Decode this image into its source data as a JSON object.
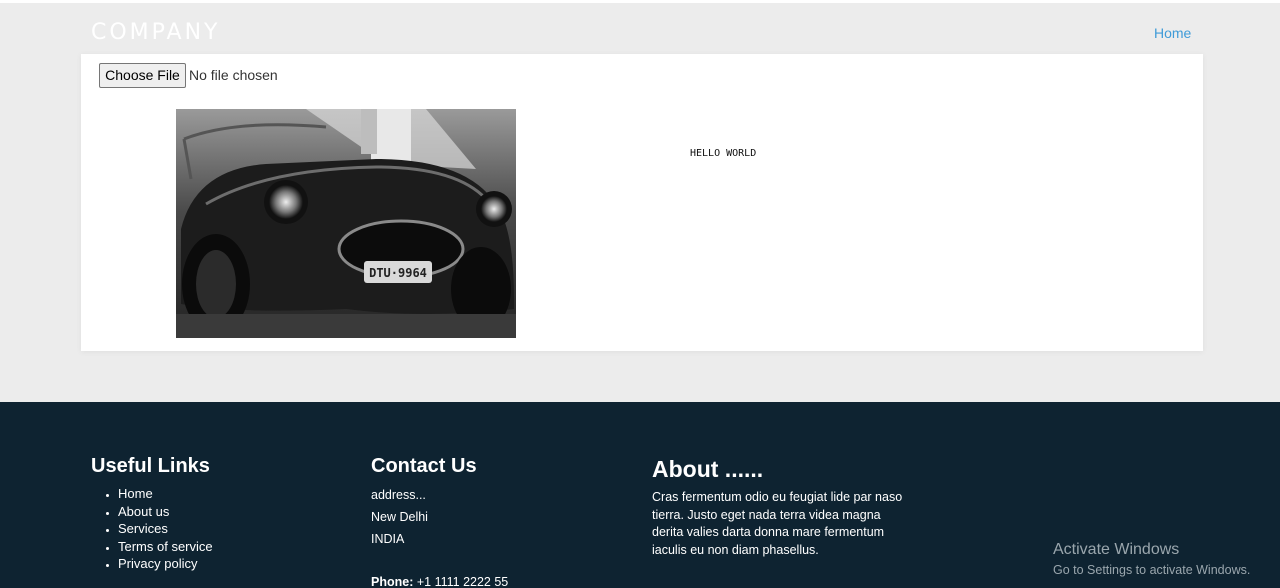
{
  "header": {
    "brand": "COMPANY",
    "nav": {
      "home": "Home"
    }
  },
  "upload": {
    "button_label": "Choose File",
    "status": "No file chosen"
  },
  "content": {
    "image_alt": "car-photo",
    "text": "HELLO WORLD"
  },
  "footer": {
    "links": {
      "title": "Useful Links",
      "items": [
        "Home",
        "About us",
        "Services",
        "Terms of service",
        "Privacy policy"
      ]
    },
    "contact": {
      "title": "Contact Us",
      "address": "address...",
      "city": "New Delhi",
      "country": "INDIA",
      "phone_label": "Phone:",
      "phone_value": "+1 1111 2222 55"
    },
    "about": {
      "title": "About ......",
      "text": "Cras fermentum odio eu feugiat lide par naso tierra. Justo eget nada terra videa magna derita valies darta donna mare fermentum iaculis eu non diam phasellus."
    }
  },
  "os_overlay": {
    "title": "Activate Windows",
    "subtitle": "Go to Settings to activate Windows."
  },
  "colors": {
    "page_bg": "#ececec",
    "footer_bg": "#0e2331",
    "link": "#3f9bd8"
  }
}
